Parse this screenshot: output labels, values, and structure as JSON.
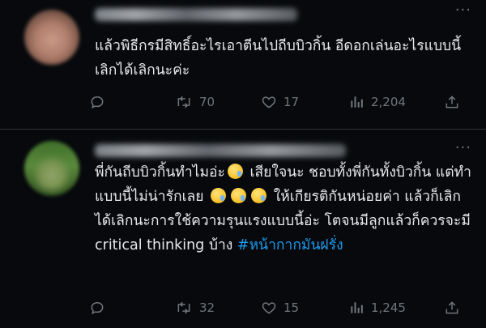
{
  "tweets": [
    {
      "body": "แล้วพิธีกรมีสิทธิ์อะไรเอาตีนไปถีบบิวกิ้น อีดอกเล่นอะไรแบบนี้เลิกได้เลิกนะค่ะ",
      "actions": {
        "retweets": "70",
        "likes": "17",
        "views": "2,204"
      }
    },
    {
      "body_part1": "พี่กันถีบบิวกิ้นทำไมอ่ะ",
      "body_part2": "เสียใจนะ ชอบทั้งพี่กันทั้งบิวกิ้น แต่ทำแบบนี้ไม่น่ารักเลย",
      "body_part3": "ให้เกียรติกันหน่อยค่า แล้วก็เลิกได้เลิกนะการใช้ความรุนแรงแบบนี้อ่ะ โตจนมีลูกแล้วก็ควรจะมี critical thinking บ้าง",
      "hashtag": "#หน้ากากมันฝรั่ง",
      "actions": {
        "retweets": "32",
        "likes": "15",
        "views": "1,245"
      }
    }
  ],
  "icons": {
    "reply": "reply-icon",
    "retweet": "retweet-icon",
    "like": "heart-icon",
    "views": "views-icon",
    "share": "share-icon",
    "more": "more-icon",
    "emoji": "crying-face-emoji"
  },
  "colors": {
    "background": "#07090c",
    "text": "#e7e9ea",
    "muted": "#71767b",
    "link": "#1d9bf0"
  }
}
